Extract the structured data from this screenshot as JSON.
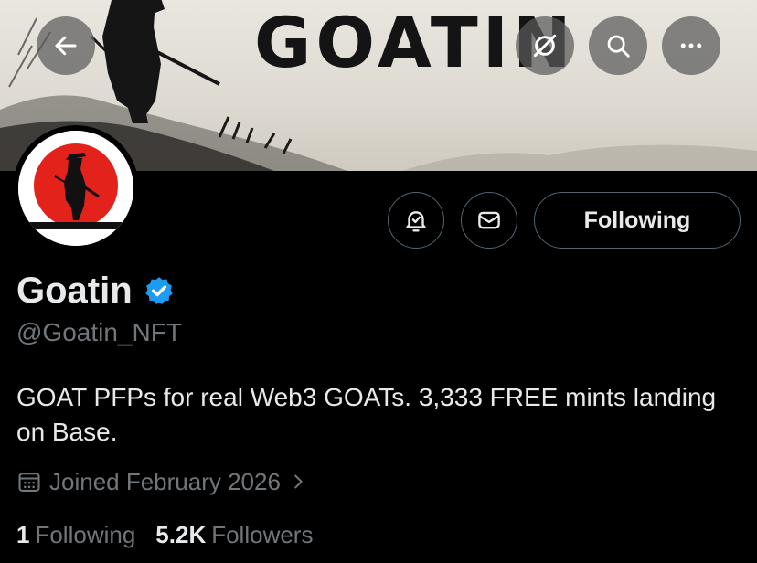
{
  "banner": {
    "title": "GOATIN",
    "background_color": "#e3dfd7"
  },
  "toolbar": {
    "back_icon": "arrow-left-icon",
    "grok_icon": "slashed-circle-icon",
    "search_icon": "search-icon",
    "more_icon": "more-horizontal-icon"
  },
  "profile": {
    "display_name": "Goatin",
    "verified_color": "#1d9bf0",
    "handle": "@Goatin_NFT",
    "bio": "GOAT PFPs for real Web3 GOATs. 3,333 FREE mints landing on Base.",
    "joined": "Joined February 2026",
    "avatar_sun_color": "#e3221c"
  },
  "actions": {
    "notify_icon": "bell-check-icon",
    "message_icon": "envelope-icon",
    "following_label": "Following"
  },
  "stats": {
    "following_count": "1",
    "following_label": "Following",
    "followers_count": "5.2K",
    "followers_label": "Followers"
  },
  "colors": {
    "background": "#000000",
    "text_primary": "#e7e9ea",
    "text_secondary": "#71767b",
    "border": "#536471",
    "accent": "#1d9bf0"
  }
}
